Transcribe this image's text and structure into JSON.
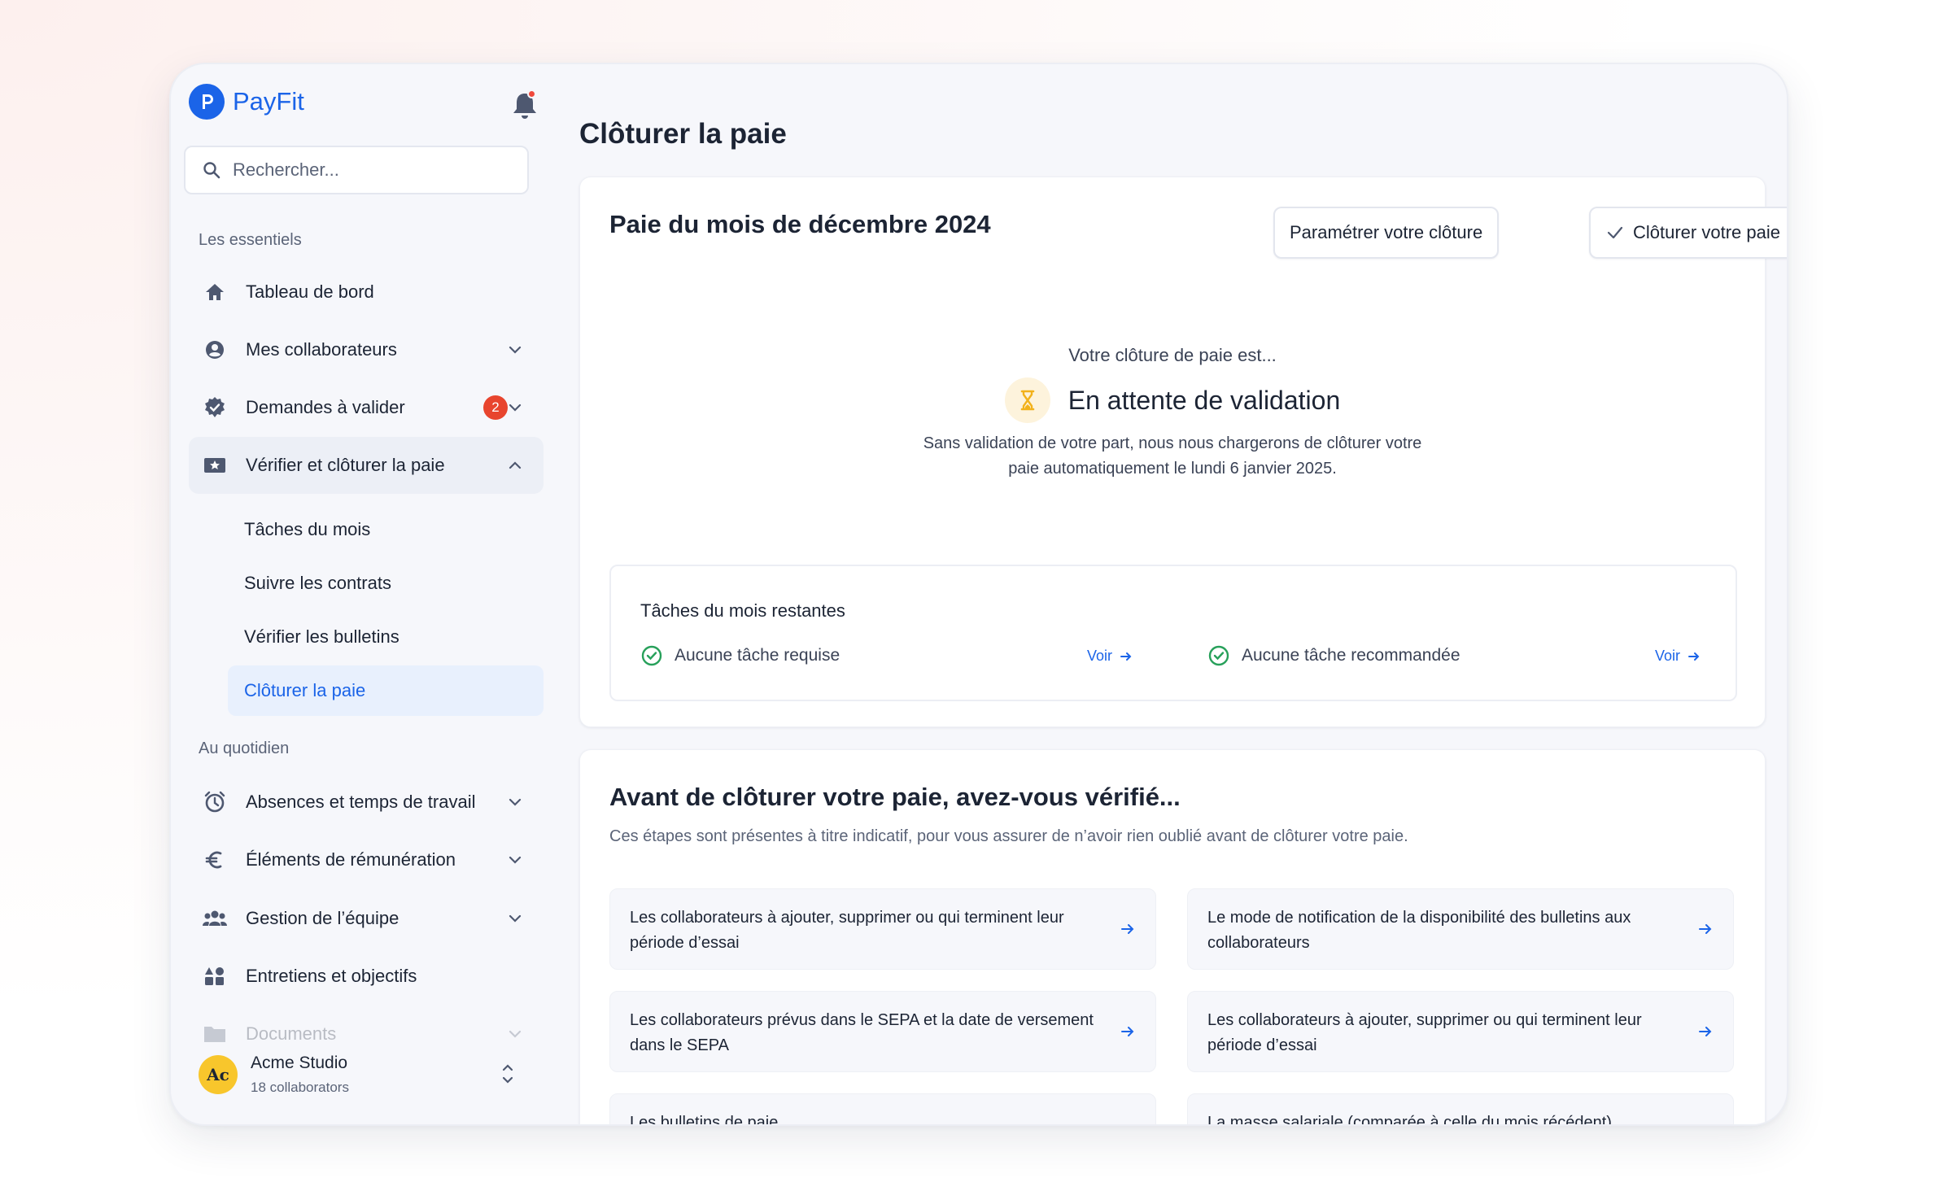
{
  "app": {
    "name": "PayFit"
  },
  "sidebar": {
    "search_placeholder": "Rechercher...",
    "section_essentials": "Les essentiels",
    "section_daily": "Au quotidien",
    "items": [
      {
        "label": "Tableau de bord",
        "icon": "home-icon"
      },
      {
        "label": "Mes collaborateurs",
        "icon": "user-circle-icon"
      },
      {
        "label": "Demandes à valider",
        "icon": "verified-badge-icon",
        "badge": "2"
      },
      {
        "label": "Vérifier et clôturer la paie",
        "icon": "payroll-star-icon"
      },
      {
        "label": "Absences et temps de travail",
        "icon": "alarm-clock-icon"
      },
      {
        "label": "Éléments de rémunération",
        "icon": "euro-icon"
      },
      {
        "label": "Gestion de l’équipe",
        "icon": "team-icon"
      },
      {
        "label": "Entretiens et objectifs",
        "icon": "shapes-icon"
      },
      {
        "label": "Documents",
        "icon": "folder-icon"
      }
    ],
    "sub_items": [
      {
        "label": "Tâches du mois"
      },
      {
        "label": "Suivre les contrats"
      },
      {
        "label": "Vérifier les bulletins"
      },
      {
        "label": "Clôturer la paie"
      }
    ],
    "account": {
      "initials": "Ac",
      "name": "Acme Studio",
      "subtitle": "18 collaborators"
    }
  },
  "main": {
    "page_title": "Clôturer la paie",
    "payroll_card": {
      "title": "Paie du mois de décembre 2024",
      "btn_settings": "Paramétrer votre clôture",
      "btn_close": "Clôturer votre paie",
      "status_intro": "Votre clôture de paie est...",
      "status_title": "En attente de validation",
      "status_desc_line1": "Sans validation de votre part, nous nous chargerons de clôturer votre",
      "status_desc_line2": "paie automatiquement le lundi 6 janvier 2025.",
      "tasks": {
        "title": "Tâches du mois restantes",
        "required": "Aucune tâche requise",
        "recommended": "Aucune tâche recommandée",
        "voir_label": "Voir"
      }
    },
    "checklist_card": {
      "title": "Avant de clôturer votre paie, avez-vous vérifié...",
      "description": "Ces étapes sont présentes à titre indicatif, pour vous assurer de n’avoir rien oublié avant de clôturer votre paie.",
      "items": [
        "Les collaborateurs à ajouter, supprimer ou qui terminent leur période d’essai",
        "Le mode de notification de la disponibilité des bulletins aux collaborateurs",
        "Les collaborateurs prévus dans le SEPA et la date de versement dans le SEPA",
        "Les collaborateurs à ajouter, supprimer ou qui terminent leur période d’essai",
        "Les bulletins de paie",
        "La masse salariale (comparée à celle du mois récédent)"
      ]
    }
  },
  "colors": {
    "brand": "#1b64e8",
    "badge": "#e8452e",
    "success": "#27a05a",
    "pending": "#f2b21c"
  }
}
